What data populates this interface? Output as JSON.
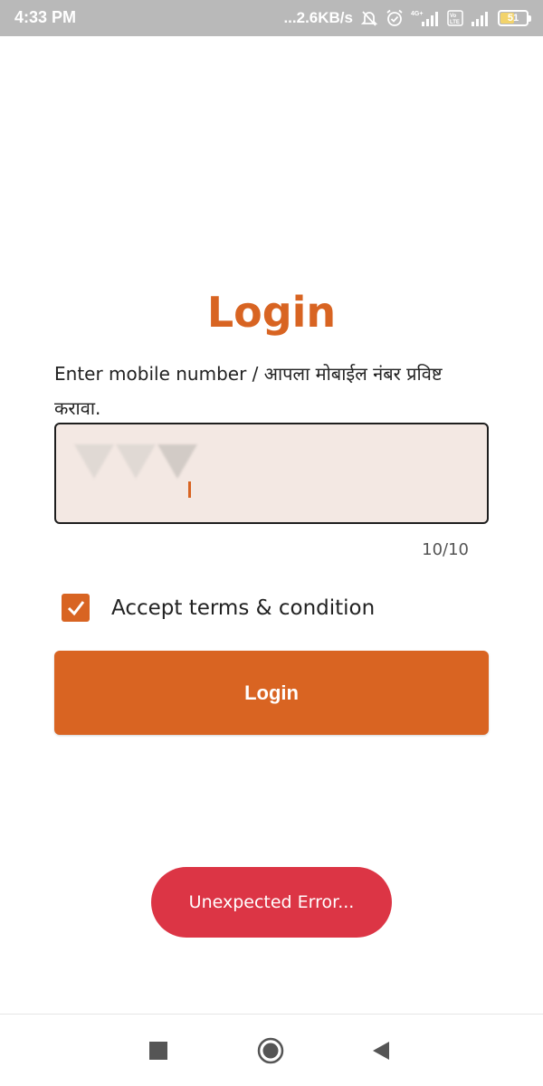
{
  "status_bar": {
    "time": "4:33 PM",
    "net_speed": "...2.6KB/s",
    "network_label": "4G+",
    "volte_label": "Vo LTE",
    "battery_level": "51",
    "icons": [
      "muted-bell-icon",
      "alarm-icon",
      "signal-icon",
      "volte-icon",
      "signal-icon",
      "battery-icon"
    ]
  },
  "login": {
    "title": "Login",
    "instruction": "Enter mobile number / आपला मोबाईल नंबर प्रविष्ट करावा.",
    "input_value_masked": true,
    "char_counter": "10/10",
    "terms_label": "Accept terms & condition",
    "terms_checked": true,
    "button_label": "Login"
  },
  "toast": {
    "message": "Unexpected Error..."
  },
  "nav_bar": {
    "icons": [
      "recents-icon",
      "home-icon",
      "back-icon"
    ]
  },
  "colors": {
    "accent": "#d86422",
    "input_bg": "#f3e8e3",
    "error": "#dc3545",
    "status_bar_bg": "#b9b9b9"
  }
}
